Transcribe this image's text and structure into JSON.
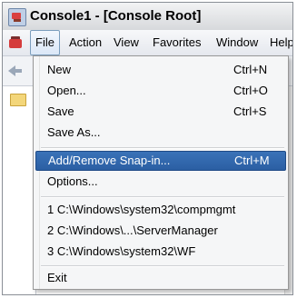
{
  "window": {
    "title": "Console1 - [Console Root]"
  },
  "menubar": {
    "items": [
      {
        "label": "File",
        "active": true
      },
      {
        "label": "Action"
      },
      {
        "label": "View"
      },
      {
        "label": "Favorites"
      },
      {
        "label": "Window"
      },
      {
        "label": "Help"
      }
    ]
  },
  "file_menu": {
    "items": [
      {
        "label": "New",
        "shortcut": "Ctrl+N"
      },
      {
        "label": "Open...",
        "shortcut": "Ctrl+O"
      },
      {
        "label": "Save",
        "shortcut": "Ctrl+S"
      },
      {
        "label": "Save As...",
        "shortcut": ""
      },
      {
        "label": "Add/Remove Snap-in...",
        "shortcut": "Ctrl+M",
        "highlighted": true
      },
      {
        "label": "Options...",
        "shortcut": ""
      },
      {
        "label": "1 C:\\Windows\\system32\\compmgmt",
        "shortcut": ""
      },
      {
        "label": "2 C:\\Windows\\...\\ServerManager",
        "shortcut": ""
      },
      {
        "label": "3 C:\\Windows\\system32\\WF",
        "shortcut": ""
      },
      {
        "label": "Exit",
        "shortcut": ""
      }
    ]
  },
  "icons": {
    "app": "mmc-console-icon",
    "menubar": "console-document-icon",
    "back": "back-arrow-icon",
    "tree": "folder-icon"
  },
  "colors": {
    "highlight": "#2f64a8",
    "menu_background": "#f5f6f7"
  }
}
